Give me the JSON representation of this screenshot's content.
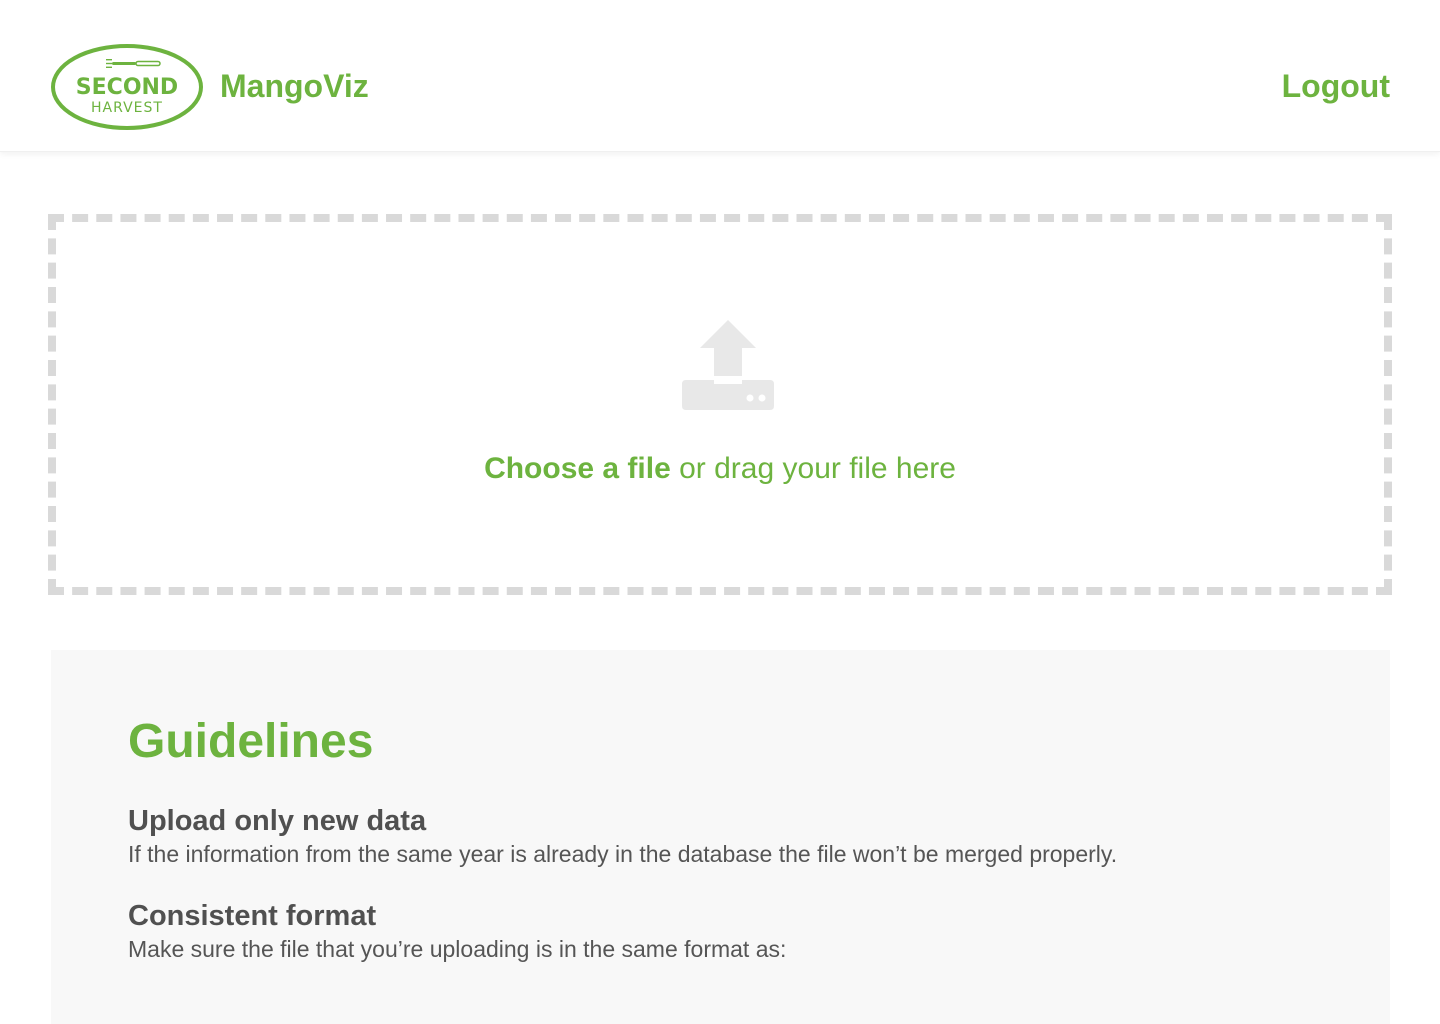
{
  "header": {
    "logo": {
      "line1": "SECOND",
      "line2": "HARVEST"
    },
    "brand": "MangoViz",
    "logout_label": "Logout"
  },
  "upload": {
    "choose_label": "Choose a file",
    "drag_text": " or drag your file here"
  },
  "guidelines": {
    "title": "Guidelines",
    "items": [
      {
        "heading": "Upload only new data",
        "text": "If the information from the same year is already in the database the file won’t be merged properly."
      },
      {
        "heading": "Consistent format",
        "text": "Make sure the file that you’re uploading is in the same format as:"
      }
    ]
  },
  "colors": {
    "accent": "#6db33f",
    "dash": "#d9d9d9",
    "panel": "#f8f8f8",
    "heading": "#505050",
    "icon": "#e8e8e8"
  },
  "icons": [
    "upload-icon",
    "fork-icon"
  ]
}
